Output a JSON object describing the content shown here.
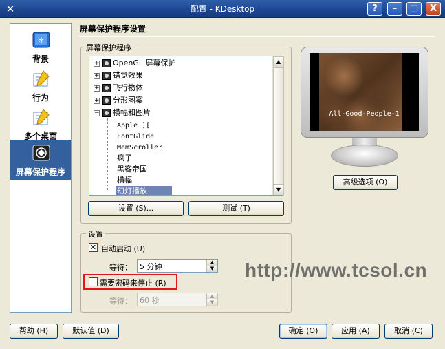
{
  "window": {
    "title": "配置 - KDesktop",
    "help_label": "?",
    "minimize_label": "–",
    "maximize_label": "□",
    "close_label": "X"
  },
  "sidebar": {
    "items": [
      {
        "label": "背景",
        "icon": "background-icon"
      },
      {
        "label": "行为",
        "icon": "behavior-icon"
      },
      {
        "label": "多个桌面",
        "icon": "multiple-desktops-icon"
      },
      {
        "label": "屏幕保护程序",
        "icon": "screensaver-icon",
        "active": true
      }
    ]
  },
  "page_title": "屏幕保护程序设置",
  "screensaver_group": {
    "legend": "屏幕保护程序",
    "tree": [
      {
        "label": "OpenGL 屏幕保护",
        "expanded": false
      },
      {
        "label": "错觉效果",
        "expanded": false
      },
      {
        "label": "飞行物体",
        "expanded": false
      },
      {
        "label": "分形图案",
        "expanded": false
      },
      {
        "label": "横幅和图片",
        "expanded": true
      }
    ],
    "children": [
      {
        "label": "Apple ][",
        "mono": true
      },
      {
        "label": "FontGlide",
        "mono": true
      },
      {
        "label": "MemScroller",
        "mono": true
      },
      {
        "label": "疯子"
      },
      {
        "label": "黑客帝国"
      },
      {
        "label": "横幅"
      },
      {
        "label": "幻灯播放",
        "selected": true
      }
    ],
    "setup_button": "设置 (S)...",
    "test_button": "测试 (T)"
  },
  "preview": {
    "caption": "All-Good-People-1",
    "advanced_button": "高级选项 (O)"
  },
  "settings_group": {
    "legend": "设置",
    "autostart_label": "自动启动 (U)",
    "autostart_checked": true,
    "wait_label": "等待：",
    "wait_value": "5 分钟",
    "password_label": "需要密码来停止 (R)",
    "password_checked": false,
    "wait2_label": "等待：",
    "wait2_value": "60 秒"
  },
  "footer": {
    "help_button": "帮助 (H)",
    "defaults_button": "默认值 (D)",
    "ok_button": "确定 (O)",
    "apply_button": "应用 (A)",
    "cancel_button": "取消 (C)"
  },
  "watermark": "http://www.tcsol.cn",
  "colors": {
    "titlebar": "#1c4591",
    "sidebar_active": "#34609e",
    "selection": "#6d84b4",
    "highlight_box": "#e01818"
  }
}
